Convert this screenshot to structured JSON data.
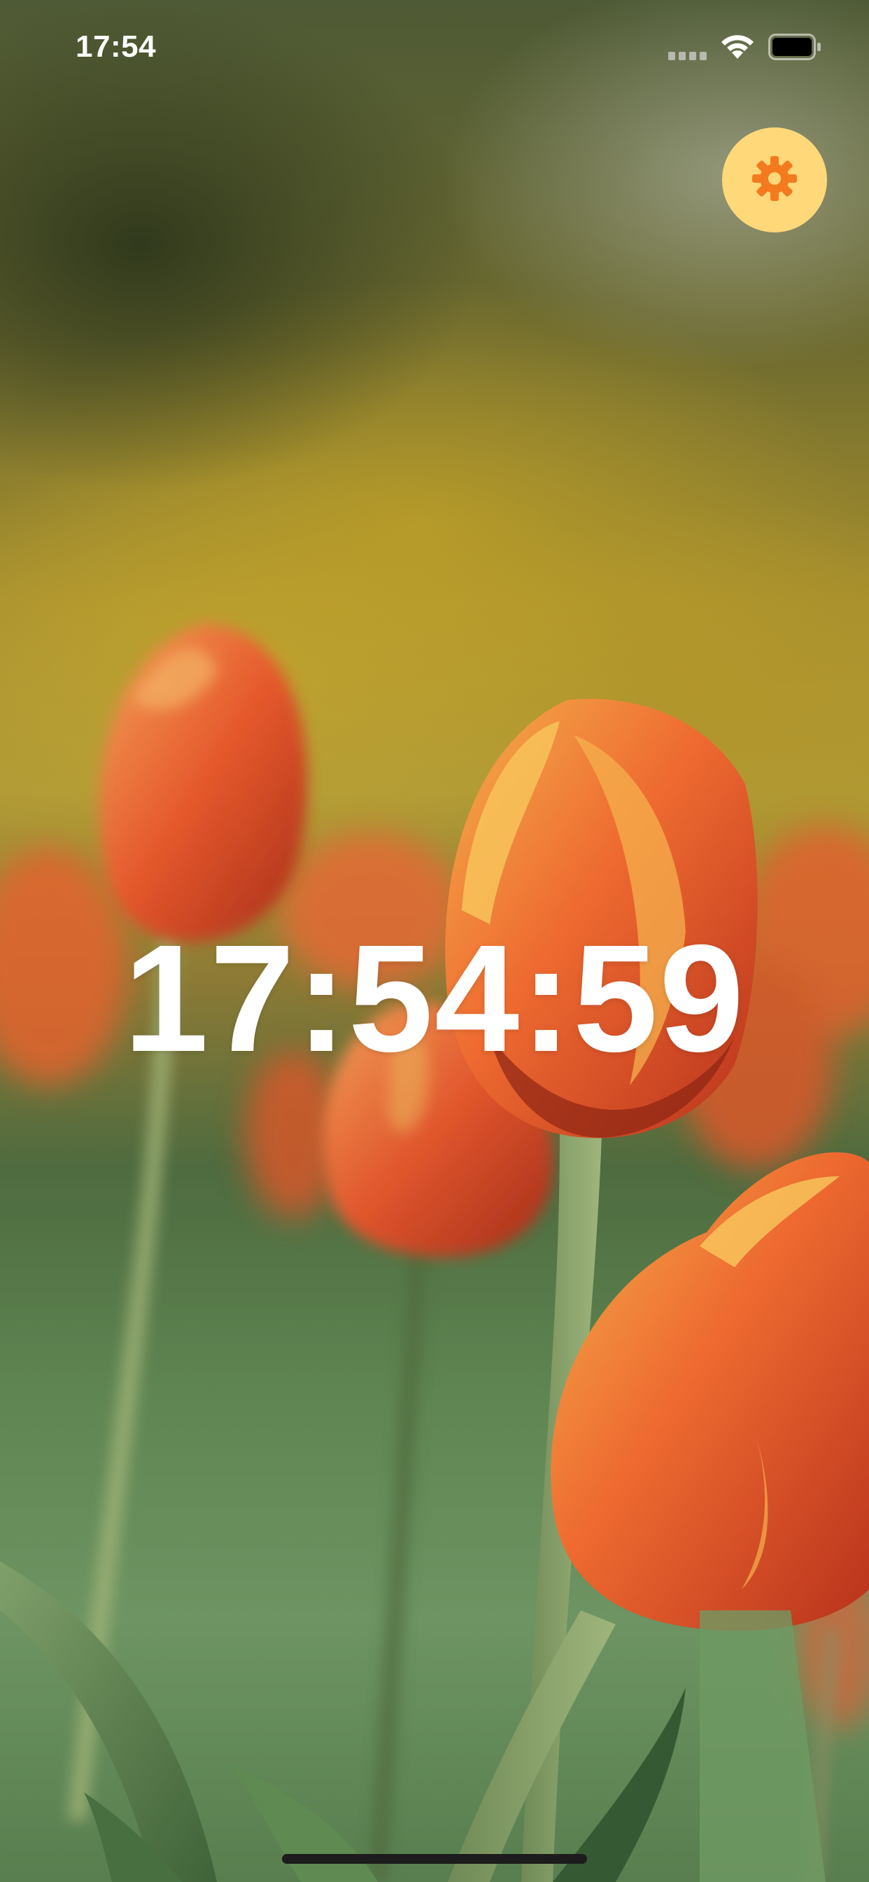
{
  "status_bar": {
    "time": "17:54",
    "icons": [
      "cellular-signal-icon",
      "wifi-icon",
      "battery-icon"
    ]
  },
  "settings_button": {
    "icon": "gear-icon",
    "background_color": "#ffd87a",
    "icon_color": "#f47a1f"
  },
  "clock": {
    "time": "17:54:59"
  },
  "background": {
    "subject": "tulips-photo"
  }
}
